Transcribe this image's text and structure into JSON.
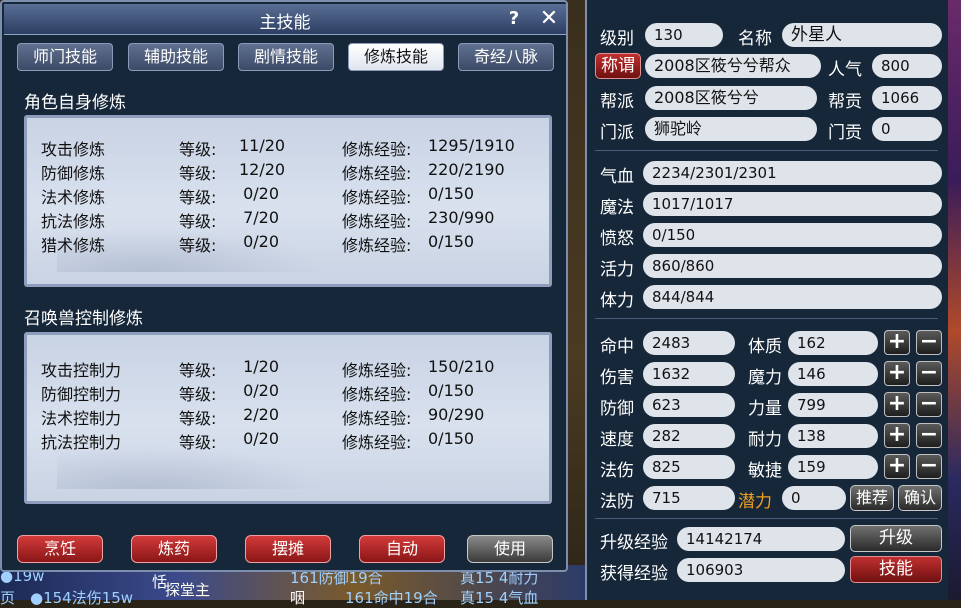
{
  "window": {
    "title": "主技能",
    "help": "?",
    "close": "✕"
  },
  "tabs": [
    "师门技能",
    "辅助技能",
    "剧情技能",
    "修炼技能",
    "奇经八脉"
  ],
  "self_section": {
    "title": "角色自身修炼",
    "rows": [
      {
        "name": "攻击修炼",
        "level_label": "等级:",
        "level": "11/20",
        "exp_label": "修炼经验:",
        "exp": "1295/1910"
      },
      {
        "name": "防御修炼",
        "level_label": "等级:",
        "level": "12/20",
        "exp_label": "修炼经验:",
        "exp": "220/2190"
      },
      {
        "name": "法术修炼",
        "level_label": "等级:",
        "level": "0/20",
        "exp_label": "修炼经验:",
        "exp": "0/150"
      },
      {
        "name": "抗法修炼",
        "level_label": "等级:",
        "level": "7/20",
        "exp_label": "修炼经验:",
        "exp": "230/990"
      },
      {
        "name": "猎术修炼",
        "level_label": "等级:",
        "level": "0/20",
        "exp_label": "修炼经验:",
        "exp": "0/150"
      }
    ]
  },
  "pet_section": {
    "title": "召唤兽控制修炼",
    "rows": [
      {
        "name": "攻击控制力",
        "level_label": "等级:",
        "level": "1/20",
        "exp_label": "修炼经验:",
        "exp": "150/210"
      },
      {
        "name": "防御控制力",
        "level_label": "等级:",
        "level": "0/20",
        "exp_label": "修炼经验:",
        "exp": "0/150"
      },
      {
        "name": "法术控制力",
        "level_label": "等级:",
        "level": "2/20",
        "exp_label": "修炼经验:",
        "exp": "90/290"
      },
      {
        "name": "抗法控制力",
        "level_label": "等级:",
        "level": "0/20",
        "exp_label": "修炼经验:",
        "exp": "0/150"
      }
    ]
  },
  "bottom_buttons": [
    "烹饪",
    "炼药",
    "摆摊",
    "自动",
    "使用"
  ],
  "background_text": [
    "●19w",
    "恬",
    "探堂主",
    "161防御19合",
    "真15 4耐力",
    "●154法伤15w",
    "161命中19合",
    "真15 4气血",
    "咽",
    "页"
  ],
  "char": {
    "level_label": "级别",
    "level": "130",
    "name_label": "名称",
    "name": "外星人",
    "title_btn": "称谓",
    "title": "2008区筱兮兮帮众",
    "pop_label": "人气",
    "pop": "800",
    "guild_label": "帮派",
    "guild": "2008区筱兮兮",
    "contrib_label": "帮贡",
    "contrib": "1066",
    "sect_label": "门派",
    "sect": "狮驼岭",
    "sect_contrib_label": "门贡",
    "sect_contrib": "0"
  },
  "vitals": [
    {
      "label": "气血",
      "value": "2234/2301/2301"
    },
    {
      "label": "魔法",
      "value": "1017/1017"
    },
    {
      "label": "愤怒",
      "value": "0/150"
    },
    {
      "label": "活力",
      "value": "860/860"
    },
    {
      "label": "体力",
      "value": "844/844"
    }
  ],
  "combat": [
    {
      "label": "命中",
      "value": "2483",
      "attr_label": "体质",
      "attr": "162"
    },
    {
      "label": "伤害",
      "value": "1632",
      "attr_label": "魔力",
      "attr": "146"
    },
    {
      "label": "防御",
      "value": "623",
      "attr_label": "力量",
      "attr": "799"
    },
    {
      "label": "速度",
      "value": "282",
      "attr_label": "耐力",
      "attr": "138"
    },
    {
      "label": "法伤",
      "value": "825",
      "attr_label": "敏捷",
      "attr": "159"
    }
  ],
  "magic_def": {
    "label": "法防",
    "value": "715"
  },
  "potential": {
    "label": "潜力",
    "value": "0",
    "recommend": "推荐",
    "confirm": "确认"
  },
  "exp": {
    "up_label": "升级经验",
    "up_value": "14142174",
    "upgrade_btn": "升级",
    "got_label": "获得经验",
    "got_value": "106903",
    "skill_btn": "技能"
  },
  "plus": "+",
  "minus": "−"
}
